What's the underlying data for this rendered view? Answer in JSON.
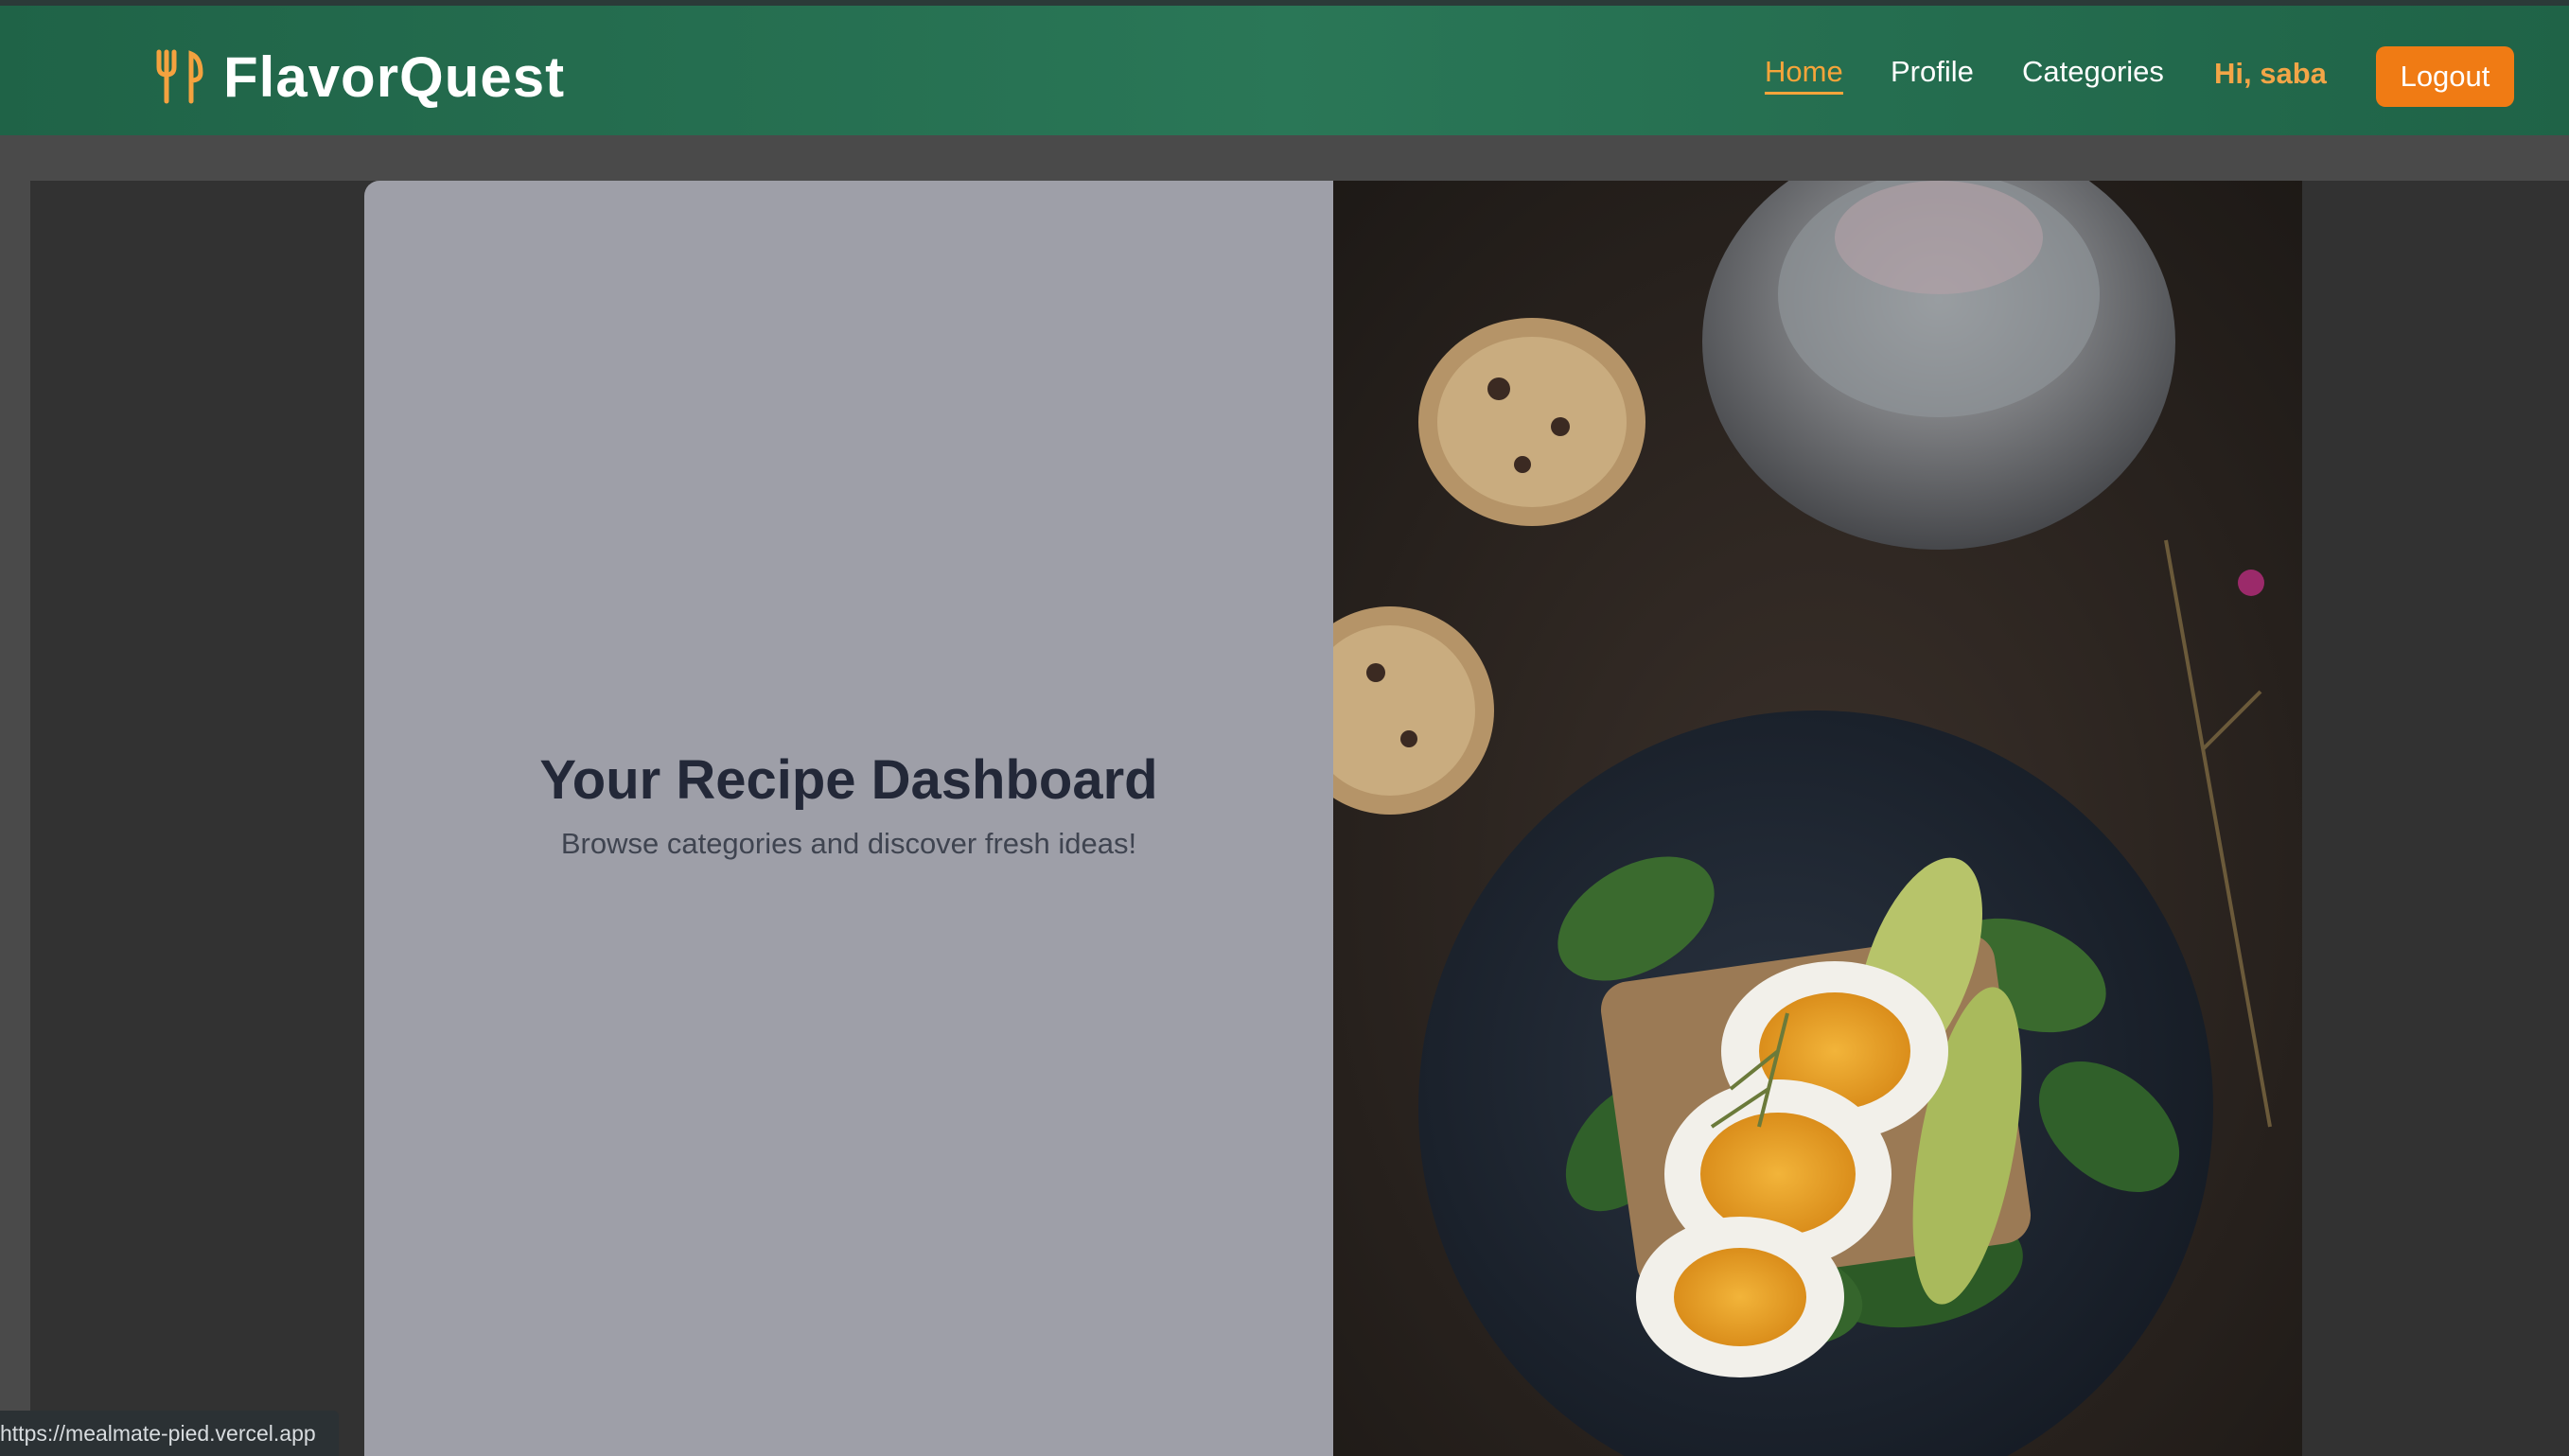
{
  "header": {
    "brand": "FlavorQuest",
    "brand_icon": "utensils-icon",
    "nav": [
      {
        "label": "Home",
        "active": true
      },
      {
        "label": "Profile",
        "active": false
      },
      {
        "label": "Categories",
        "active": false
      }
    ],
    "greeting": "Hi, saba",
    "logout_label": "Logout"
  },
  "hero": {
    "title": "Your Recipe Dashboard",
    "subtitle": "Browse categories and discover fresh ideas!",
    "image_alt": "Boiled eggs with avocado and spinach on toast, cookies and a lantern on a dark table"
  },
  "status_bar": {
    "url": "https://mealmate-pied.vercel.app"
  },
  "colors": {
    "navbar": "#2a7757",
    "accent": "#f07b14",
    "active_link": "#f6a43a",
    "card_panel": "#9e9fa8"
  }
}
